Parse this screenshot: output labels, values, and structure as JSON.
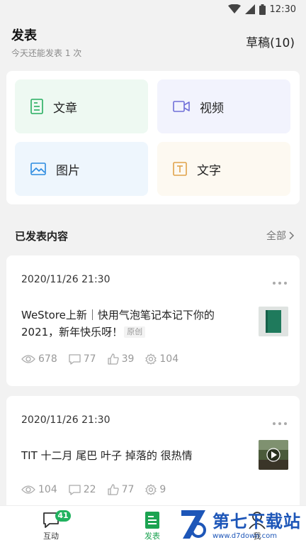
{
  "status_bar": {
    "time": "12:30"
  },
  "header": {
    "title": "发表",
    "subtitle": "今天还能发表 1 次",
    "drafts": "草稿(10)"
  },
  "publish_types": [
    {
      "label": "文章",
      "icon": "article-icon"
    },
    {
      "label": "视频",
      "icon": "video-icon"
    },
    {
      "label": "图片",
      "icon": "image-icon"
    },
    {
      "label": "文字",
      "icon": "text-icon"
    }
  ],
  "section": {
    "title": "已发表内容",
    "more": "全部"
  },
  "posts": [
    {
      "date": "2020/11/26 21:30",
      "title": "WeStore上新｜快用气泡笔记本记下你的2021，新年快乐呀！",
      "tag": "原创",
      "views": "678",
      "comments": "77",
      "likes": "39",
      "shares": "104"
    },
    {
      "date": "2020/11/26 21:30",
      "title": "TIT 十二月 尾巴 叶子 掉落的 很热情",
      "views": "104",
      "comments": "22",
      "likes": "77",
      "shares": "9"
    }
  ],
  "tab_bar": {
    "interact_label": "互动",
    "interact_badge": "41",
    "publish_label": "发表",
    "me_label": "我"
  },
  "watermark": {
    "brand": "第七下载站",
    "url": "www.d7down.com"
  },
  "colors": {
    "accent": "#1ca351",
    "badge": "#21b25f",
    "watermark": "#1d56b8"
  }
}
